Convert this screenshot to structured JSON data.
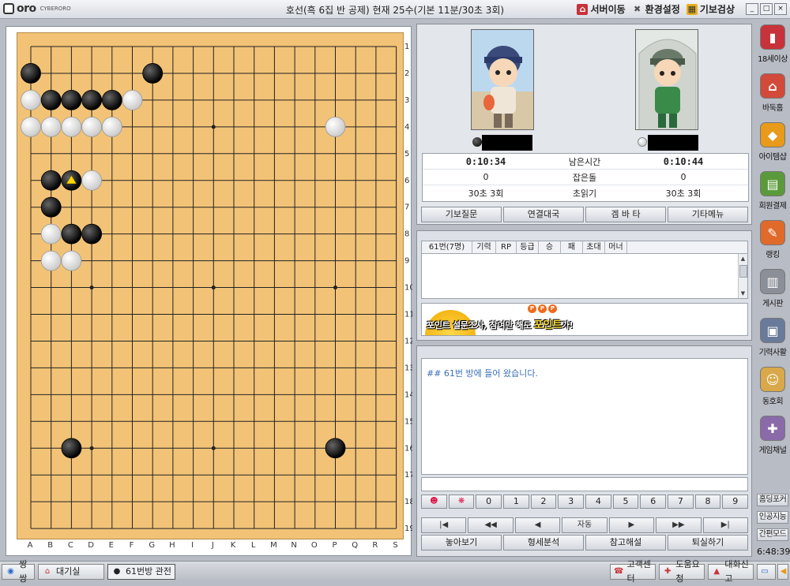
{
  "app": {
    "logo_text": "oro",
    "logo_sub": "CYBERORO"
  },
  "title": "호선(흑 6집 반 공제) 현재 25수(기본 11분/30초 3회)",
  "top_menu": [
    {
      "label": "서버이동",
      "icon": "server-icon"
    },
    {
      "label": "환경설정",
      "icon": "settings-icon"
    },
    {
      "label": "기보검상",
      "icon": "record-icon"
    }
  ],
  "window_controls": [
    "_",
    "□",
    "×"
  ],
  "board": {
    "size": 19,
    "col_labels": [
      "A",
      "B",
      "C",
      "D",
      "E",
      "F",
      "G",
      "H",
      "I",
      "J",
      "K",
      "L",
      "M",
      "N",
      "O",
      "P",
      "Q",
      "R",
      "S"
    ],
    "row_labels": [
      "1",
      "2",
      "3",
      "4",
      "5",
      "6",
      "7",
      "8",
      "9",
      "10",
      "11",
      "12",
      "13",
      "14",
      "15",
      "16",
      "17",
      "18",
      "19"
    ],
    "stones": [
      {
        "c": 0,
        "r": 1,
        "color": "black"
      },
      {
        "c": 6,
        "r": 1,
        "color": "black"
      },
      {
        "c": 0,
        "r": 2,
        "color": "white"
      },
      {
        "c": 1,
        "r": 2,
        "color": "black"
      },
      {
        "c": 2,
        "r": 2,
        "color": "black"
      },
      {
        "c": 3,
        "r": 2,
        "color": "black"
      },
      {
        "c": 4,
        "r": 2,
        "color": "black"
      },
      {
        "c": 5,
        "r": 2,
        "color": "white"
      },
      {
        "c": 0,
        "r": 3,
        "color": "white"
      },
      {
        "c": 1,
        "r": 3,
        "color": "white"
      },
      {
        "c": 2,
        "r": 3,
        "color": "white"
      },
      {
        "c": 3,
        "r": 3,
        "color": "white"
      },
      {
        "c": 4,
        "r": 3,
        "color": "white"
      },
      {
        "c": 15,
        "r": 3,
        "color": "white"
      },
      {
        "c": 1,
        "r": 5,
        "color": "black"
      },
      {
        "c": 2,
        "r": 5,
        "color": "black",
        "last": true
      },
      {
        "c": 3,
        "r": 5,
        "color": "white"
      },
      {
        "c": 1,
        "r": 6,
        "color": "black"
      },
      {
        "c": 1,
        "r": 7,
        "color": "white"
      },
      {
        "c": 2,
        "r": 7,
        "color": "black"
      },
      {
        "c": 3,
        "r": 7,
        "color": "black"
      },
      {
        "c": 1,
        "r": 8,
        "color": "white"
      },
      {
        "c": 2,
        "r": 8,
        "color": "white"
      },
      {
        "c": 2,
        "r": 15,
        "color": "black"
      },
      {
        "c": 15,
        "r": 15,
        "color": "black"
      }
    ]
  },
  "players": {
    "black": {
      "time": "0:10:34",
      "captured": "0",
      "byoyomi": "30초 3회"
    },
    "white": {
      "time": "0:10:44",
      "captured": "0",
      "byoyomi": "30초 3회"
    },
    "labels": {
      "time": "남은시간",
      "captured": "잡은돌",
      "byoyomi": "초읽기"
    }
  },
  "player_buttons": [
    "기보질문",
    "연결대국",
    "겜 바 타",
    "기타메뉴"
  ],
  "user_list": {
    "headers": [
      "61번(7명)",
      "기력",
      "RP",
      "등급",
      "승",
      "패",
      "초대",
      "머너"
    ]
  },
  "banner": {
    "text_a": "포인트 설문조사, 참여만 해도 ",
    "text_b": "포인트",
    "text_c": "가!",
    "dots": [
      "P",
      "P",
      "P"
    ]
  },
  "chat": {
    "message": "## 61번 방에 들어 왔습니다."
  },
  "number_buttons": [
    "0",
    "1",
    "2",
    "3",
    "4",
    "5",
    "6",
    "7",
    "8",
    "9"
  ],
  "nav_buttons": [
    "|◀",
    "◀◀",
    "◀",
    "자동",
    "▶",
    "▶▶",
    "▶|"
  ],
  "action_buttons": [
    "놓아보기",
    "형세분석",
    "참고해설",
    "퇴실하기"
  ],
  "sidebar": [
    {
      "label": "18세이상",
      "icon": "adult-icon",
      "color": "#c8323a"
    },
    {
      "label": "바둑홈",
      "icon": "home-icon",
      "color": "#d24a3a"
    },
    {
      "label": "아이템샵",
      "icon": "shop-icon",
      "color": "#e89a1a"
    },
    {
      "label": "회원결제",
      "icon": "payment-icon",
      "color": "#5a9a3a"
    },
    {
      "label": "랭킹",
      "icon": "ranking-icon",
      "color": "#e06a2a"
    },
    {
      "label": "게시판",
      "icon": "board-icon",
      "color": "#8a8f98"
    },
    {
      "label": "기력사활",
      "icon": "life-death-icon",
      "color": "#6a7a9a"
    },
    {
      "label": "동호회",
      "icon": "club-icon",
      "color": "#d8a84a"
    },
    {
      "label": "게임채널",
      "icon": "game-channel-icon",
      "color": "#8a6aa8"
    }
  ],
  "sidebar_small": [
    "홈딩포커",
    "인공지능",
    "간편모드"
  ],
  "clock": "6:48:39",
  "taskbar": {
    "left": [
      {
        "label": "쌍쌍",
        "icon": "globe-icon"
      },
      {
        "label": "대기실",
        "icon": "lobby-icon"
      },
      {
        "label": "61번방 관전",
        "icon": "stones-icon",
        "active": true
      }
    ],
    "right": [
      {
        "label": "고객센터",
        "icon": "phone-icon"
      },
      {
        "label": "도움요청",
        "icon": "help-icon"
      },
      {
        "label": "대화신고",
        "icon": "report-icon"
      }
    ]
  }
}
